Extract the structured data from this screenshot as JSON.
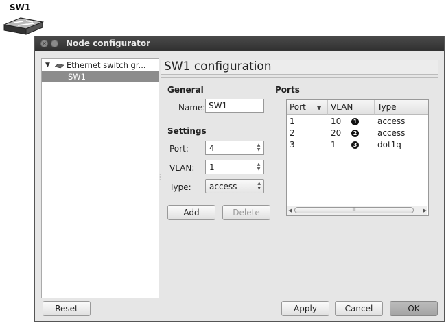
{
  "node": {
    "label": "SW1",
    "icon": "ethernet-switch-icon"
  },
  "window": {
    "title": "Node configurator",
    "close_glyph": "✕"
  },
  "tree": {
    "group_label": "Ethernet switch gr...",
    "items": [
      {
        "label": "SW1",
        "selected": true
      }
    ]
  },
  "config": {
    "header": "SW1 configuration",
    "general": {
      "section": "General",
      "name_label": "Name:",
      "name_value": "SW1"
    },
    "settings": {
      "section": "Settings",
      "port_label": "Port:",
      "port_value": "4",
      "vlan_label": "VLAN:",
      "vlan_value": "1",
      "type_label": "Type:",
      "type_value": "access"
    },
    "buttons": {
      "add": "Add",
      "delete": "Delete"
    },
    "ports": {
      "section": "Ports",
      "columns": [
        "Port",
        "VLAN",
        "Type"
      ],
      "rows": [
        {
          "port": "1",
          "vlan": "10",
          "marker": "1",
          "type": "access"
        },
        {
          "port": "2",
          "vlan": "20",
          "marker": "2",
          "type": "access"
        },
        {
          "port": "3",
          "vlan": "1",
          "marker": "3",
          "type": "dot1q"
        }
      ],
      "scroll_grip": "III"
    }
  },
  "dialog_buttons": {
    "reset": "Reset",
    "apply": "Apply",
    "cancel": "Cancel",
    "ok": "OK"
  },
  "colors": {
    "titlebar": "#3a3a3a",
    "selection": "#8c8c8c",
    "ok_button": "#b0b0b0"
  }
}
